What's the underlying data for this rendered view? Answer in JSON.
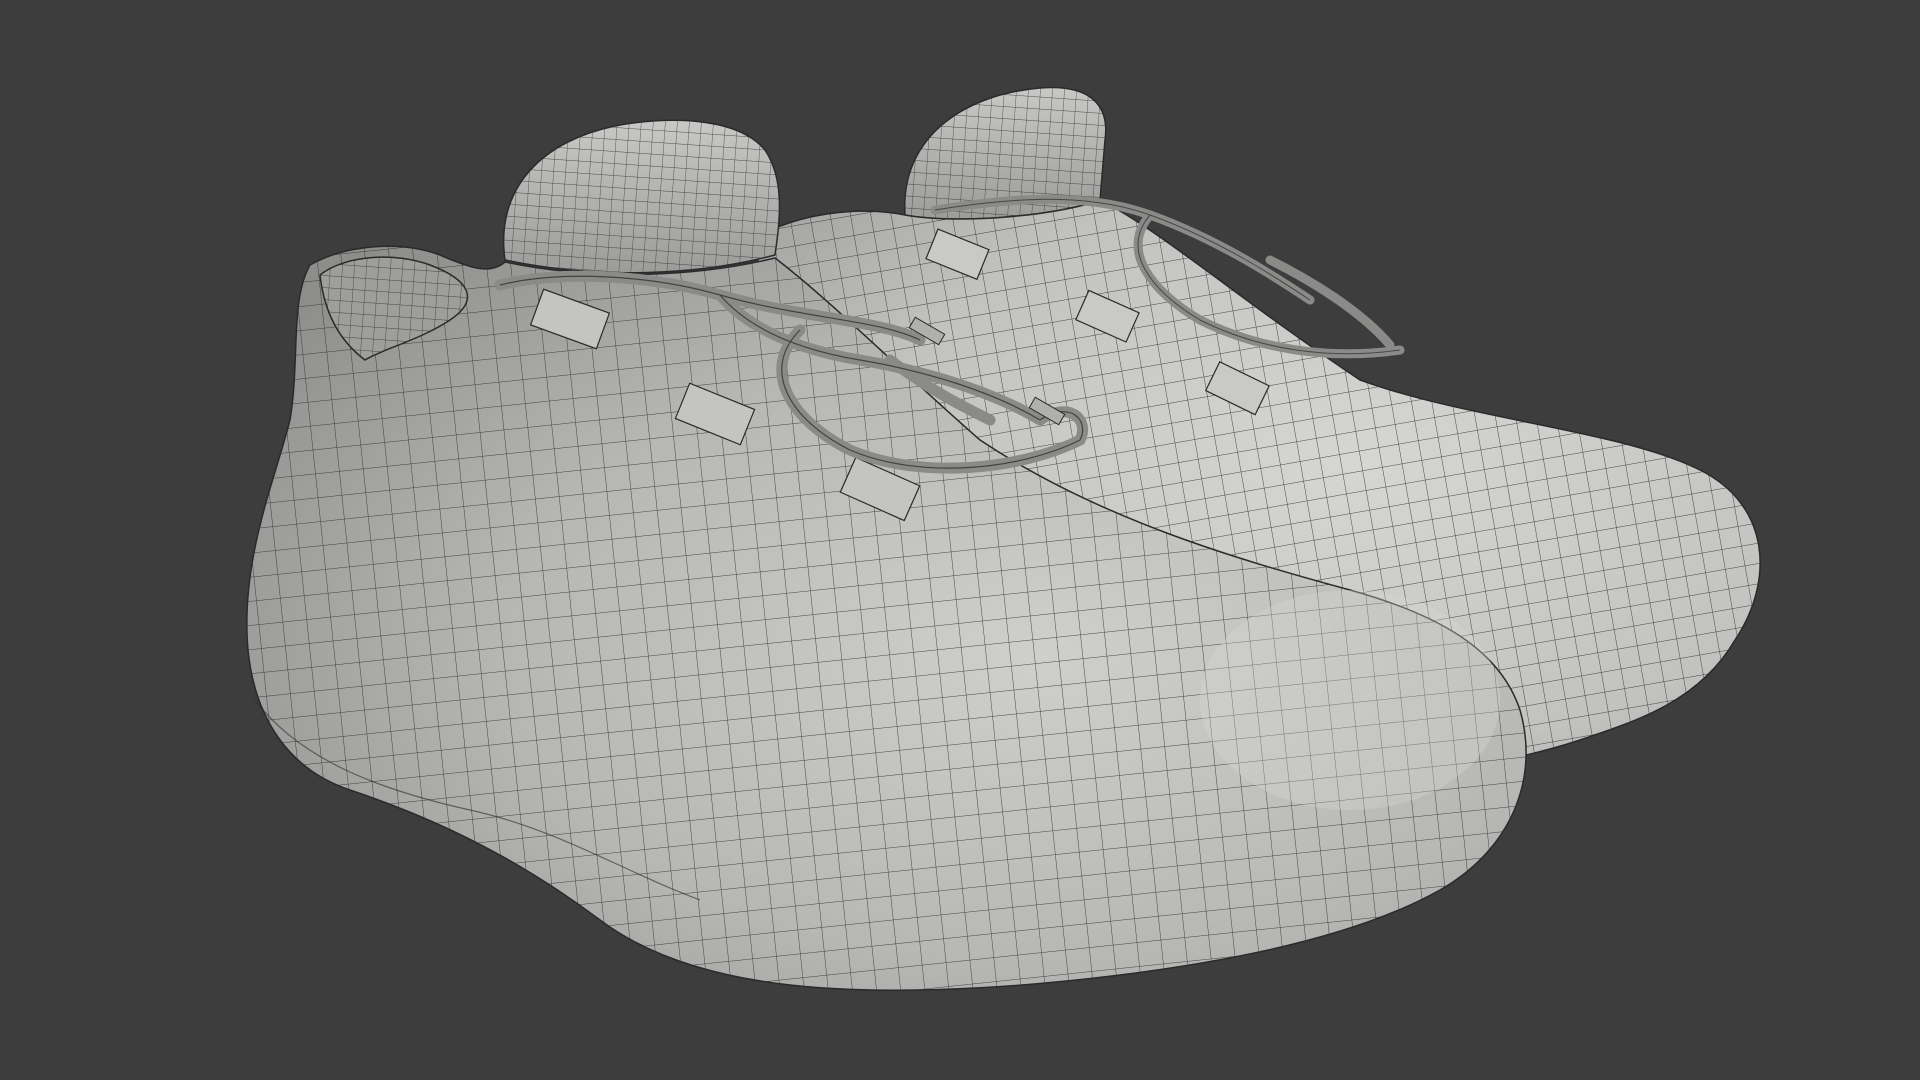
{
  "viewport": {
    "background_color": "#3d3d3d",
    "object": "pair-of-sneakers-wireframe-mesh",
    "shading": "solid-grey-with-wireframe-overlay"
  },
  "colors": {
    "mesh_light": "#d3d3d1",
    "mesh_mid": "#a9a9a7",
    "mesh_dark": "#6f6f6d",
    "wire": "#3a3a3a",
    "lace": "#8a8a88"
  }
}
